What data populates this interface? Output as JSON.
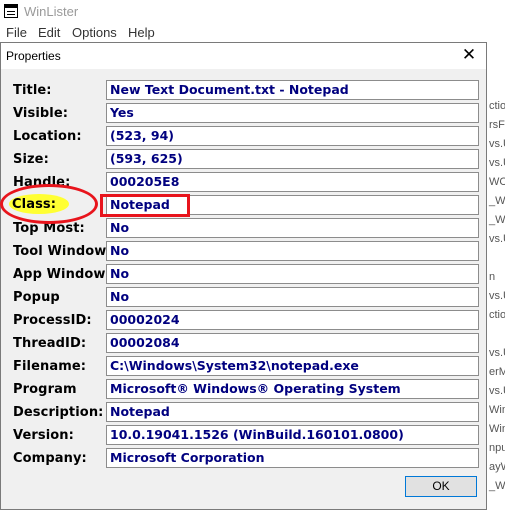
{
  "window": {
    "title": "WinLister"
  },
  "menu": [
    "File",
    "Edit",
    "Options",
    "Help"
  ],
  "background_fragments": [
    "ctio",
    "rsFo",
    "vs.U",
    "vs.U",
    "WC",
    "_W",
    "_W",
    "vs.U",
    "n",
    "vs.U",
    "ctio",
    "vs.U",
    "erM",
    "vs.U",
    "Win",
    "Win",
    "npu",
    "ayW",
    "_Win"
  ],
  "dialog": {
    "title": "Properties",
    "close_glyph": "✕",
    "ok_label": "OK",
    "rows": [
      {
        "label": "Title:",
        "value": "New Text Document.txt - Notepad"
      },
      {
        "label": "Visible:",
        "value": "Yes"
      },
      {
        "label": "Location:",
        "value": "(523, 94)"
      },
      {
        "label": "Size:",
        "value": "(593, 625)"
      },
      {
        "label": "Handle:",
        "value": "000205E8"
      },
      {
        "label": "Class:",
        "value": "Notepad"
      },
      {
        "label": "Top Most:",
        "value": "No"
      },
      {
        "label": "Tool Window:",
        "value": "No"
      },
      {
        "label": "App Window:",
        "value": "No"
      },
      {
        "label": "Popup",
        "value": "No"
      },
      {
        "label": "ProcessID:",
        "value": "00002024"
      },
      {
        "label": "ThreadID:",
        "value": "00002084"
      },
      {
        "label": "Filename:",
        "value": "C:\\Windows\\System32\\notepad.exe"
      },
      {
        "label": "Program",
        "value": "Microsoft® Windows® Operating System"
      },
      {
        "label": "Description:",
        "value": "Notepad"
      },
      {
        "label": "Version:",
        "value": "10.0.19041.1526 (WinBuild.160101.0800)"
      },
      {
        "label": "Company:",
        "value": "Microsoft Corporation"
      }
    ]
  },
  "annotations": {
    "color": "#e8141c",
    "highlight_color": "#ffff33"
  }
}
